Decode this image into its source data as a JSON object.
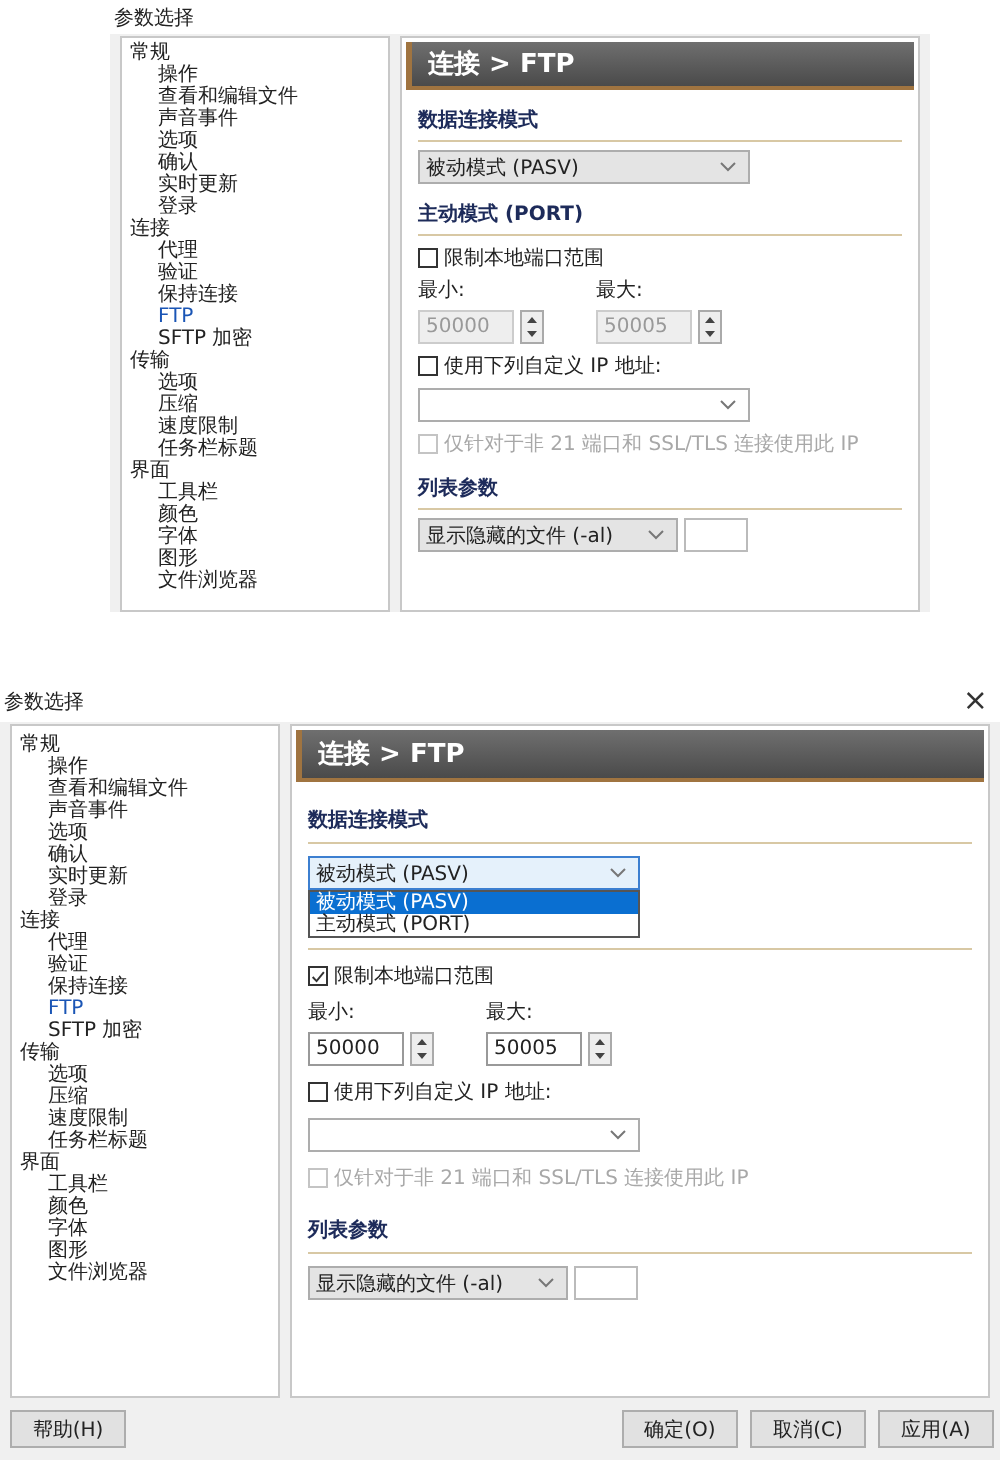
{
  "screenshots": [
    {
      "window": {
        "title": "参数选择"
      },
      "tree": [
        {
          "label": "常规",
          "selected": false,
          "children": [
            {
              "label": "操作",
              "selected": false
            },
            {
              "label": "查看和编辑文件",
              "selected": false
            },
            {
              "label": "声音事件",
              "selected": false
            },
            {
              "label": "选项",
              "selected": false
            },
            {
              "label": "确认",
              "selected": false
            },
            {
              "label": "实时更新",
              "selected": false
            },
            {
              "label": "登录",
              "selected": false
            }
          ]
        },
        {
          "label": "连接",
          "selected": false,
          "children": [
            {
              "label": "代理",
              "selected": false
            },
            {
              "label": "验证",
              "selected": false
            },
            {
              "label": "保持连接",
              "selected": false
            },
            {
              "label": "FTP",
              "selected": true
            },
            {
              "label": "SFTP 加密",
              "selected": false
            }
          ]
        },
        {
          "label": "传输",
          "selected": false,
          "children": [
            {
              "label": "选项",
              "selected": false
            },
            {
              "label": "压缩",
              "selected": false
            },
            {
              "label": "速度限制",
              "selected": false
            },
            {
              "label": "任务栏标题",
              "selected": false
            }
          ]
        },
        {
          "label": "界面",
          "selected": false,
          "children": [
            {
              "label": "工具栏",
              "selected": false
            },
            {
              "label": "颜色",
              "selected": false
            },
            {
              "label": "字体",
              "selected": false
            },
            {
              "label": "图形",
              "selected": false
            },
            {
              "label": "文件浏览器",
              "selected": false
            }
          ]
        }
      ],
      "panel": {
        "header": "连接 > FTP",
        "mode_heading": "数据连接模式",
        "mode_dropdown": {
          "value": "被动模式 (PASV)",
          "expanded": false
        },
        "port_heading": "主动模式 (PORT)",
        "limit_ports": {
          "label": "限制本地端口范围",
          "checked": false
        },
        "min": {
          "label": "最小:",
          "value": "50000",
          "disabled": true
        },
        "max": {
          "label": "最大:",
          "value": "50005",
          "disabled": true
        },
        "custom_ip": {
          "label": "使用下列自定义 IP 地址:",
          "checked": false
        },
        "ip_only": {
          "label": "仅针对于非 21 端口和 SSL/TLS 连接使用此 IP",
          "checked": false,
          "disabled": true
        },
        "list_heading": "列表参数",
        "list_dropdown": {
          "value": "显示隐藏的文件 (-al)"
        }
      }
    },
    {
      "window": {
        "title": "参数选择",
        "close": "×"
      },
      "tree": [
        {
          "label": "常规",
          "selected": false,
          "children": [
            {
              "label": "操作",
              "selected": false
            },
            {
              "label": "查看和编辑文件",
              "selected": false
            },
            {
              "label": "声音事件",
              "selected": false
            },
            {
              "label": "选项",
              "selected": false
            },
            {
              "label": "确认",
              "selected": false
            },
            {
              "label": "实时更新",
              "selected": false
            },
            {
              "label": "登录",
              "selected": false
            }
          ]
        },
        {
          "label": "连接",
          "selected": false,
          "children": [
            {
              "label": "代理",
              "selected": false
            },
            {
              "label": "验证",
              "selected": false
            },
            {
              "label": "保持连接",
              "selected": false
            },
            {
              "label": "FTP",
              "selected": true
            },
            {
              "label": "SFTP 加密",
              "selected": false
            }
          ]
        },
        {
          "label": "传输",
          "selected": false,
          "children": [
            {
              "label": "选项",
              "selected": false
            },
            {
              "label": "压缩",
              "selected": false
            },
            {
              "label": "速度限制",
              "selected": false
            },
            {
              "label": "任务栏标题",
              "selected": false
            }
          ]
        },
        {
          "label": "界面",
          "selected": false,
          "children": [
            {
              "label": "工具栏",
              "selected": false
            },
            {
              "label": "颜色",
              "selected": false
            },
            {
              "label": "字体",
              "selected": false
            },
            {
              "label": "图形",
              "selected": false
            },
            {
              "label": "文件浏览器",
              "selected": false
            }
          ]
        }
      ],
      "panel": {
        "header": "连接 > FTP",
        "mode_heading": "数据连接模式",
        "mode_dropdown": {
          "value": "被动模式 (PASV)",
          "expanded": true,
          "options": [
            {
              "label": "被动模式 (PASV)",
              "selected": true
            },
            {
              "label": "主动模式 (PORT)",
              "selected": false
            }
          ]
        },
        "limit_ports": {
          "label": "限制本地端口范围",
          "checked": true
        },
        "min": {
          "label": "最小:",
          "value": "50000",
          "disabled": false
        },
        "max": {
          "label": "最大:",
          "value": "50005",
          "disabled": false
        },
        "custom_ip": {
          "label": "使用下列自定义 IP 地址:",
          "checked": false
        },
        "ip_only": {
          "label": "仅针对于非 21 端口和 SSL/TLS 连接使用此 IP",
          "checked": false,
          "disabled": true
        },
        "list_heading": "列表参数",
        "list_dropdown": {
          "value": "显示隐藏的文件 (-al)"
        }
      },
      "buttons": [
        {
          "label": "帮助(H)"
        },
        {
          "label": "确定(O)"
        },
        {
          "label": "取消(C)"
        },
        {
          "label": "应用(A)"
        }
      ]
    }
  ]
}
